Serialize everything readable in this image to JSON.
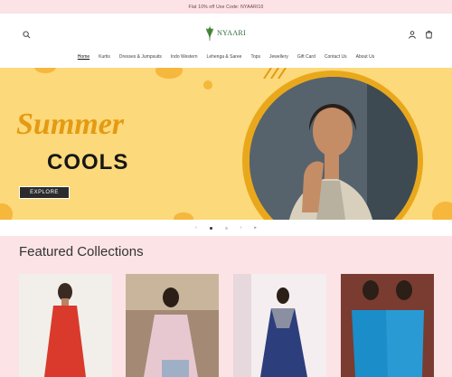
{
  "announcement": "Flat 10% off Use Code: NYAARI10",
  "brand": {
    "name": "NYAARI"
  },
  "nav": {
    "items": [
      "Home",
      "Kurtis",
      "Dresses & Jumpsuits",
      "Indo Western",
      "Lehenga & Saree",
      "Tops",
      "Jewellery",
      "Gift Card",
      "Contact Us",
      "About Us"
    ],
    "active": "Home"
  },
  "hero": {
    "line1": "Summer",
    "line2": "COOLS",
    "cta": "EXPLORE",
    "slides": 4,
    "current_slide": 1
  },
  "featured": {
    "title": "Featured Collections"
  },
  "icons": [
    "search-icon",
    "account-icon",
    "cart-icon",
    "prev-arrow-icon",
    "next-arrow-icon",
    "play-icon"
  ],
  "colors": {
    "announcement_bg": "#fbe3e6",
    "hero_bg": "#fcd97a",
    "accent": "#e49a12",
    "featured_bg": "#fbe3e6"
  }
}
